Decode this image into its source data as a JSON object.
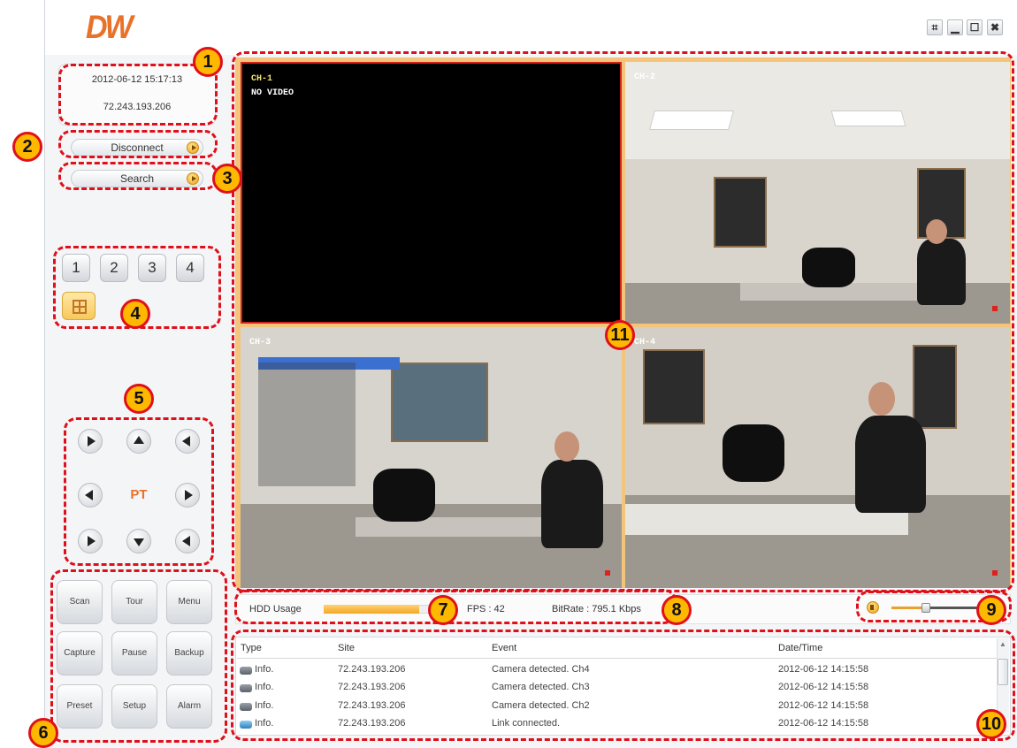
{
  "app": {
    "logo_text": "DW",
    "window_buttons": {
      "fit": "⌗",
      "minimize": "▁",
      "maximize": "☐",
      "close": "✖"
    }
  },
  "info": {
    "datetime": "2012-06-12 15:17:13",
    "ip": "72.243.193.206"
  },
  "buttons": {
    "disconnect": "Disconnect",
    "search": "Search"
  },
  "channels": [
    "1",
    "2",
    "3",
    "4"
  ],
  "ptz": {
    "label": "PT"
  },
  "functions": [
    "Scan",
    "Tour",
    "Menu",
    "Capture",
    "Pause",
    "Backup",
    "Preset",
    "Setup",
    "Alarm"
  ],
  "cameras": [
    {
      "label": "CH-1",
      "status": "NO VIDEO"
    },
    {
      "label": "CH-2"
    },
    {
      "label": "CH-3"
    },
    {
      "label": "CH-4"
    }
  ],
  "status": {
    "hdd_label": "HDD Usage",
    "hdd_usage_fraction": 0.9,
    "fps": "FPS : 42",
    "bitrate": "BitRate : 795.1 Kbps",
    "volume_fraction": 0.35
  },
  "log": {
    "columns": [
      "Type",
      "Site",
      "Event",
      "Date/Time"
    ],
    "rows": [
      {
        "type": "Info.",
        "site": "72.243.193.206",
        "event": "Camera detected. Ch4",
        "datetime": "2012-06-12 14:15:58",
        "icon": "camera-icon"
      },
      {
        "type": "Info.",
        "site": "72.243.193.206",
        "event": "Camera detected. Ch3",
        "datetime": "2012-06-12 14:15:58",
        "icon": "camera-icon"
      },
      {
        "type": "Info.",
        "site": "72.243.193.206",
        "event": "Camera detected. Ch2",
        "datetime": "2012-06-12 14:15:58",
        "icon": "camera-icon"
      },
      {
        "type": "Info.",
        "site": "72.243.193.206",
        "event": "Link connected.",
        "datetime": "2012-06-12 14:15:58",
        "icon": "link-icon"
      }
    ]
  },
  "annotations": [
    "1",
    "2",
    "3",
    "4",
    "5",
    "6",
    "7",
    "8",
    "9",
    "10",
    "11"
  ],
  "colors": {
    "accent": "#e8722a",
    "annotation_red": "#e0101a",
    "annotation_badge": "#ffb800"
  }
}
